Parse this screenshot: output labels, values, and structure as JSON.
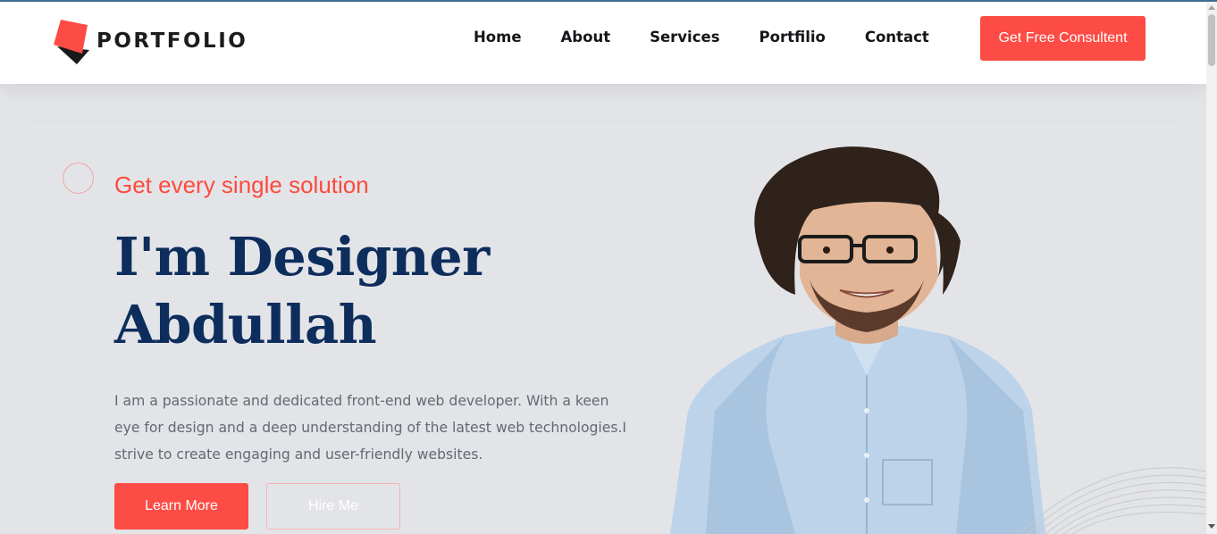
{
  "brand": {
    "name": "PORTFOLIO",
    "colors": {
      "accent": "#fd4c45",
      "navy": "#0d2d5c",
      "text": "#656872"
    }
  },
  "nav": {
    "items": [
      "Home",
      "About",
      "Services",
      "Portfilio",
      "Contact"
    ]
  },
  "header": {
    "cta_label": "Get Free Consultent"
  },
  "hero": {
    "tagline": "Get every single solution",
    "headline_line1": "I'm Designer",
    "headline_line2": "Abdullah",
    "description_lines": [
      "I am a passionate and dedicated front-end web developer. With a keen",
      "eye for design and a deep understanding of the latest web technologies.I",
      "strive to create engaging and user-friendly websites."
    ],
    "learn_more_label": "Learn More",
    "hire_me_label": "Hire Me",
    "image_subject": "smiling-man-portrait"
  },
  "icons": {
    "logo": "portfolio-logo-icon",
    "circle": "decorative-circle",
    "arcs": "decorative-arc-lines"
  }
}
